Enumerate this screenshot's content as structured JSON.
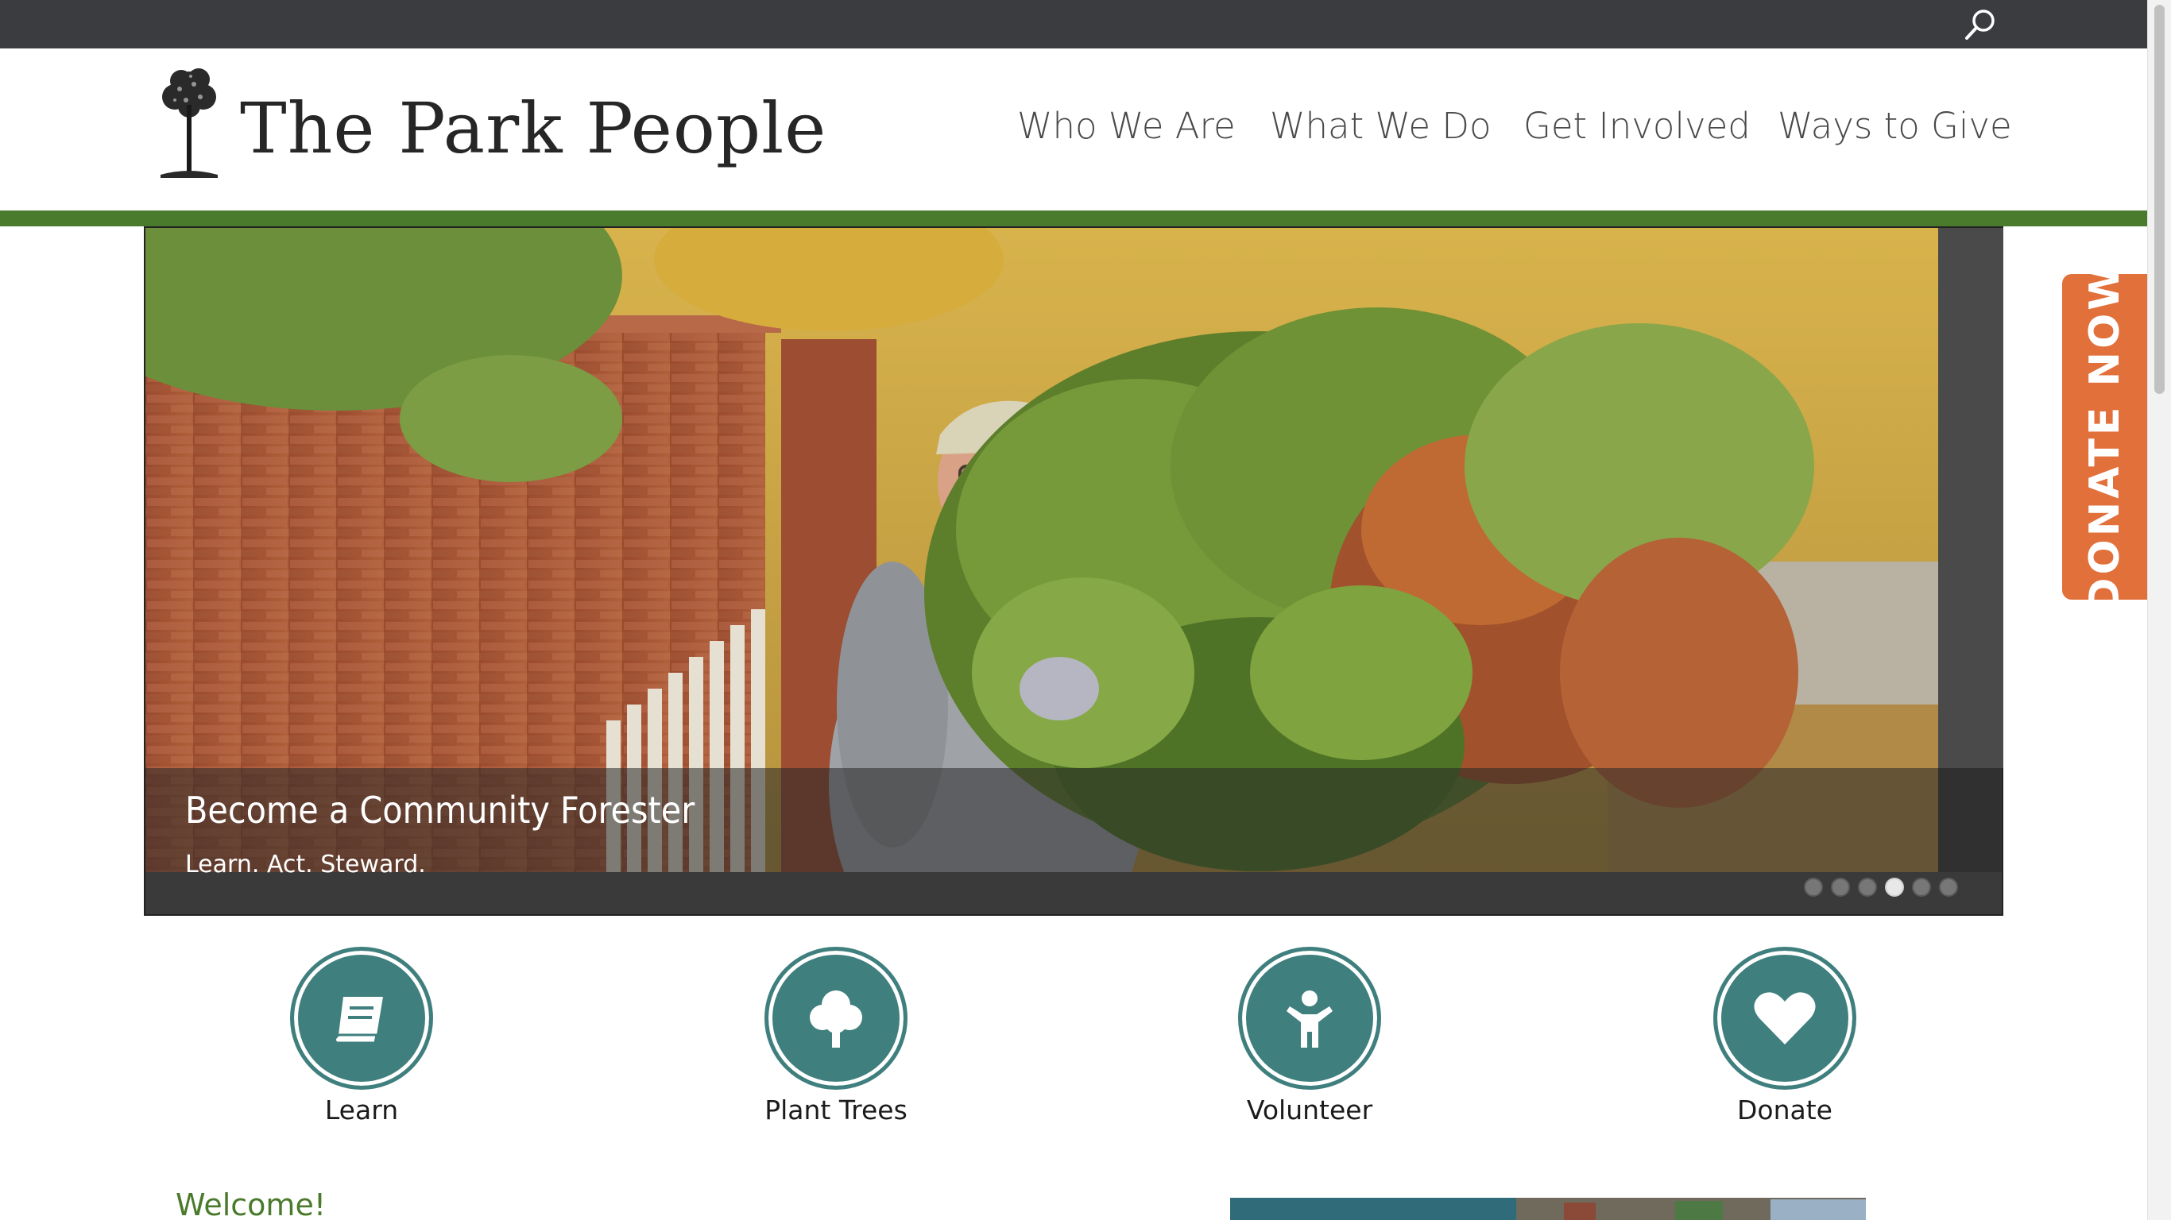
{
  "header": {
    "logo_text": "The Park People",
    "nav": [
      {
        "label": "Who We Are"
      },
      {
        "label": "What We Do"
      },
      {
        "label": "Get Involved"
      },
      {
        "label": "Ways to Give"
      }
    ]
  },
  "donate_tab": {
    "label": "DONATE NOW"
  },
  "slider": {
    "title": "Become a Community Forester",
    "subtitle": "Learn.  Act.  Steward.",
    "dot_count": 6,
    "active_dot": 4
  },
  "features": [
    {
      "label": "Learn",
      "icon": "book-icon"
    },
    {
      "label": "Plant Trees",
      "icon": "tree-icon"
    },
    {
      "label": "Volunteer",
      "icon": "person-icon"
    },
    {
      "label": "Donate",
      "icon": "heart-icon"
    }
  ],
  "welcome": {
    "heading": "Welcome!"
  },
  "colors": {
    "topbar": "#3b3c40",
    "brand_green": "#4a7a2b",
    "teal": "#3f7f7e",
    "donate_orange": "#e2703a"
  }
}
